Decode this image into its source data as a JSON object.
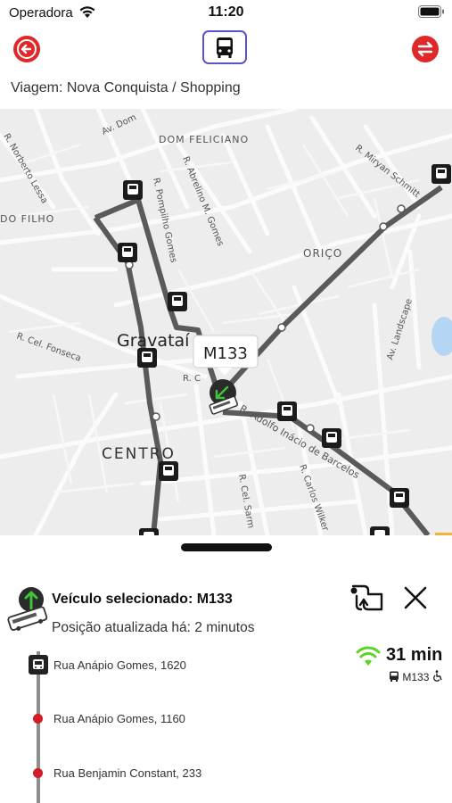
{
  "status": {
    "carrier": "Operadora",
    "time": "11:20"
  },
  "header": {
    "trip_label": "Viagem: Nova Conquista / Shopping"
  },
  "map": {
    "labels": {
      "dom_feliciano": "DOM FELICIANO",
      "orico": "ORIÇO",
      "do_filho": "DO FILHO",
      "centro": "CENTRO",
      "gravatai": "Gravataí",
      "norberto": "R. Norberto Lessa",
      "av_dom": "Av. Dom",
      "abrelino": "R. Abrelino M. Gomes",
      "pompilho": "R. Pompilho Gomes",
      "miryan": "R. Miryan Schmitt",
      "fonseca": "R. Cel. Fonseca",
      "landscape": "Av. Landscape",
      "adolfo": "R. Adolfo Inácio de Barcelos",
      "carlos": "R. Carlos Wilker",
      "sarmento": "R. Cel. Sarm",
      "r_c": "R. C"
    },
    "vehicle_callout": "M133"
  },
  "sheet": {
    "vehicle_title": "Veículo selecionado: M133",
    "updated": "Posição atualizada há: 2 minutos",
    "eta": {
      "time": "31 min",
      "line": "M133"
    },
    "stops": [
      {
        "name": "Rua Anápio Gomes, 1620"
      },
      {
        "name": "Rua Anápio Gomes, 1160"
      },
      {
        "name": "Rua Benjamin Constant, 233"
      }
    ]
  },
  "colors": {
    "accent_red": "#e02828",
    "purple": "#5b53c9",
    "wifi_green": "#5bd424"
  }
}
